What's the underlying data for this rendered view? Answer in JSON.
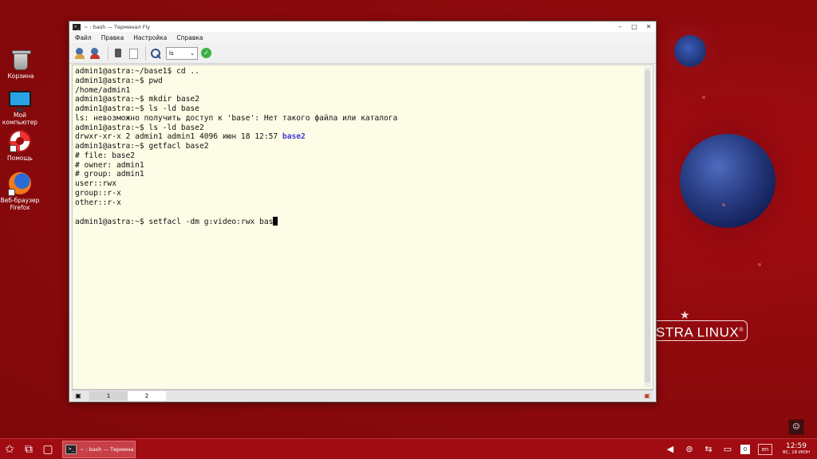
{
  "desktop": {
    "icons": [
      {
        "label": "Корзина"
      },
      {
        "label": "Мой компьютер"
      },
      {
        "label": "Помощь"
      },
      {
        "label": "Веб-браузер Firefox"
      }
    ],
    "brand": "STRA LINUX"
  },
  "window": {
    "title": "~ : bash — Терминал Fly",
    "menu": [
      "Файл",
      "Правка",
      "Настройка",
      "Справка"
    ],
    "toolbar": {
      "combo_value": "ls",
      "icons": [
        "add-user-icon",
        "remove-user-icon",
        "copy-icon",
        "paste-icon",
        "search-icon",
        "ok-icon"
      ]
    },
    "terminal": {
      "lines": [
        "admin1@astra:~/base1$ cd ..",
        "admin1@astra:~$ pwd",
        "/home/admin1",
        "admin1@astra:~$ mkdir base2",
        "admin1@astra:~$ ls -ld base",
        "ls: невозможно получить доступ к 'base': Нет такого файла или каталога",
        "admin1@astra:~$ ls -ld base2"
      ],
      "ls_output_prefix": "drwxr-xr-x 2 admin1 admin1 4096 июн 18 12:57 ",
      "ls_output_dir": "base2",
      "lines_after": [
        "admin1@astra:~$ getfacl base2",
        "# file: base2",
        "# owner: admin1",
        "# group: admin1",
        "user::rwx",
        "group::r-x",
        "other::r-x",
        ""
      ],
      "current_input": "admin1@astra:~$ setfacl -dm g:video:rwx bas"
    },
    "tabs": [
      "1",
      "2"
    ],
    "active_tab": "2"
  },
  "taskbar": {
    "task_label": "~ : bash — Термина",
    "tray": {
      "kbd_indicator": "0",
      "lang": "en",
      "time": "12:59",
      "date": "ВС, 18 ИЮН"
    }
  },
  "colors": {
    "desktop_bg": "#8e0a0d",
    "terminal_bg": "#fdfce6",
    "dir_color": "#3a3ad6",
    "taskbar_bg": "#a00c11"
  }
}
